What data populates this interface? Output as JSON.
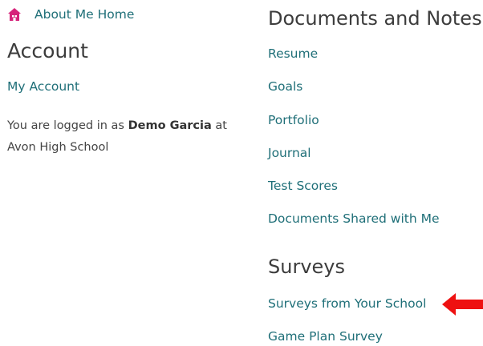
{
  "left": {
    "home_label": "About Me Home",
    "account_heading": "Account",
    "my_account_label": "My Account",
    "login": {
      "prefix": "You are logged in as ",
      "user_name": "Demo Garcia",
      "middle": " at",
      "school": "Avon High School"
    }
  },
  "right": {
    "documents_heading": "Documents and Notes",
    "documents_links": [
      "Resume",
      "Goals",
      "Portfolio",
      "Journal",
      "Test Scores",
      "Documents Shared with Me"
    ],
    "surveys_heading": "Surveys",
    "survey_links": [
      "Surveys from Your School",
      "Game Plan Survey"
    ]
  },
  "icons": {
    "home": "home-icon",
    "arrow": "arrow-left-icon"
  },
  "colors": {
    "link": "#1f6f78",
    "home_icon": "#d6237a",
    "arrow": "#ee1111"
  }
}
